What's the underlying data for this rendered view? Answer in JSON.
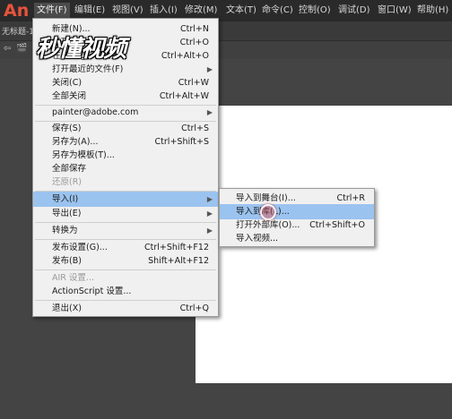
{
  "app": {
    "logo": "An",
    "doc_tab": "无标题-1"
  },
  "menubar": [
    {
      "label": "文件(F)"
    },
    {
      "label": "编辑(E)"
    },
    {
      "label": "视图(V)"
    },
    {
      "label": "插入(I)"
    },
    {
      "label": "修改(M)"
    },
    {
      "label": "文本(T)"
    },
    {
      "label": "命令(C)"
    },
    {
      "label": "控制(O)"
    },
    {
      "label": "调试(D)"
    },
    {
      "label": "窗口(W)"
    },
    {
      "label": "帮助(H)"
    }
  ],
  "watermark": "秒懂视频",
  "file_menu": [
    {
      "label": "新建(N)...",
      "shortcut": "Ctrl+N"
    },
    {
      "label": "打开...",
      "shortcut": "Ctrl+O"
    },
    {
      "label": "在 Bridge 中浏览",
      "shortcut": "Ctrl+Alt+O"
    },
    {
      "label": "打开最近的文件(F)",
      "submenu": true
    },
    {
      "label": "关闭(C)",
      "shortcut": "Ctrl+W"
    },
    {
      "label": "全部关闭",
      "shortcut": "Ctrl+Alt+W"
    },
    {
      "label": "painter@adobe.com",
      "submenu": true
    },
    {
      "label": "保存(S)",
      "shortcut": "Ctrl+S"
    },
    {
      "label": "另存为(A)...",
      "shortcut": "Ctrl+Shift+S"
    },
    {
      "label": "另存为模板(T)..."
    },
    {
      "label": "全部保存"
    },
    {
      "label": "还原(R)",
      "disabled": true
    },
    {
      "label": "导入(I)",
      "submenu": true,
      "highlighted": true
    },
    {
      "label": "导出(E)",
      "submenu": true
    },
    {
      "label": "转换为",
      "submenu": true
    },
    {
      "label": "发布设置(G)...",
      "shortcut": "Ctrl+Shift+F12"
    },
    {
      "label": "发布(B)",
      "shortcut": "Shift+Alt+F12"
    },
    {
      "label": "AIR 设置...",
      "disabled": true
    },
    {
      "label": "ActionScript 设置..."
    },
    {
      "label": "退出(X)",
      "shortcut": "Ctrl+Q"
    }
  ],
  "import_submenu": [
    {
      "label": "导入到舞台(I)...",
      "shortcut": "Ctrl+R"
    },
    {
      "label": "导入到库(L)...",
      "highlighted": true
    },
    {
      "label": "打开外部库(O)...",
      "shortcut": "Ctrl+Shift+O"
    },
    {
      "label": "导入视频..."
    }
  ],
  "colors": {
    "menubar": "#2a2a2a",
    "menu_bg": "#f0f0f0",
    "highlight": "#9bc3ef",
    "logo": "#e8533b",
    "stage": "#ffffff",
    "workspace": "#444444"
  }
}
